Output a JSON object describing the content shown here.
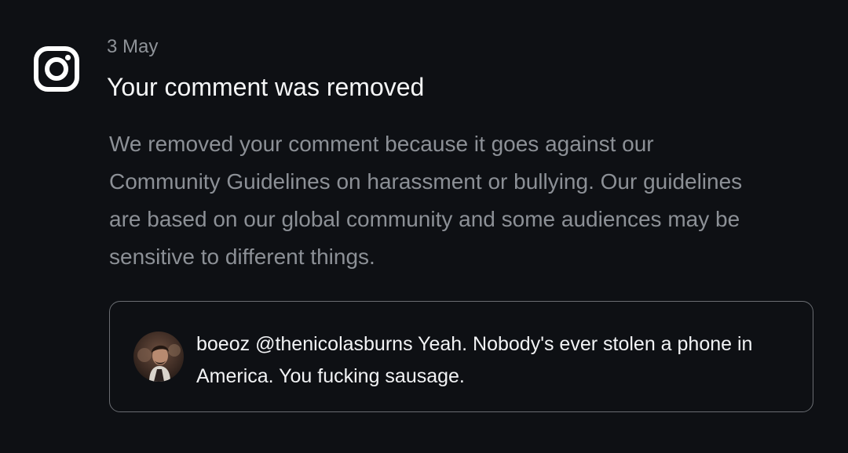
{
  "notification": {
    "app_icon": "instagram-icon",
    "date": "3 May",
    "title": "Your comment was removed",
    "body_lines": [
      "We removed your comment because it goes against our",
      "Community Guidelines on harassment or bullying. Our guidelines",
      "are based on our global community and some audiences may be",
      "sensitive to different things."
    ]
  },
  "comment": {
    "avatar": "user-avatar",
    "username": "boeoz",
    "text_lines": [
      "@thenicolasburns Yeah. Nobody's ever stolen a phone in",
      "America. You fucking sausage."
    ]
  },
  "colors": {
    "background": "#0e1014",
    "title": "#f5f6f7",
    "secondary_text": "#8c9096",
    "border": "#6a6d72"
  }
}
